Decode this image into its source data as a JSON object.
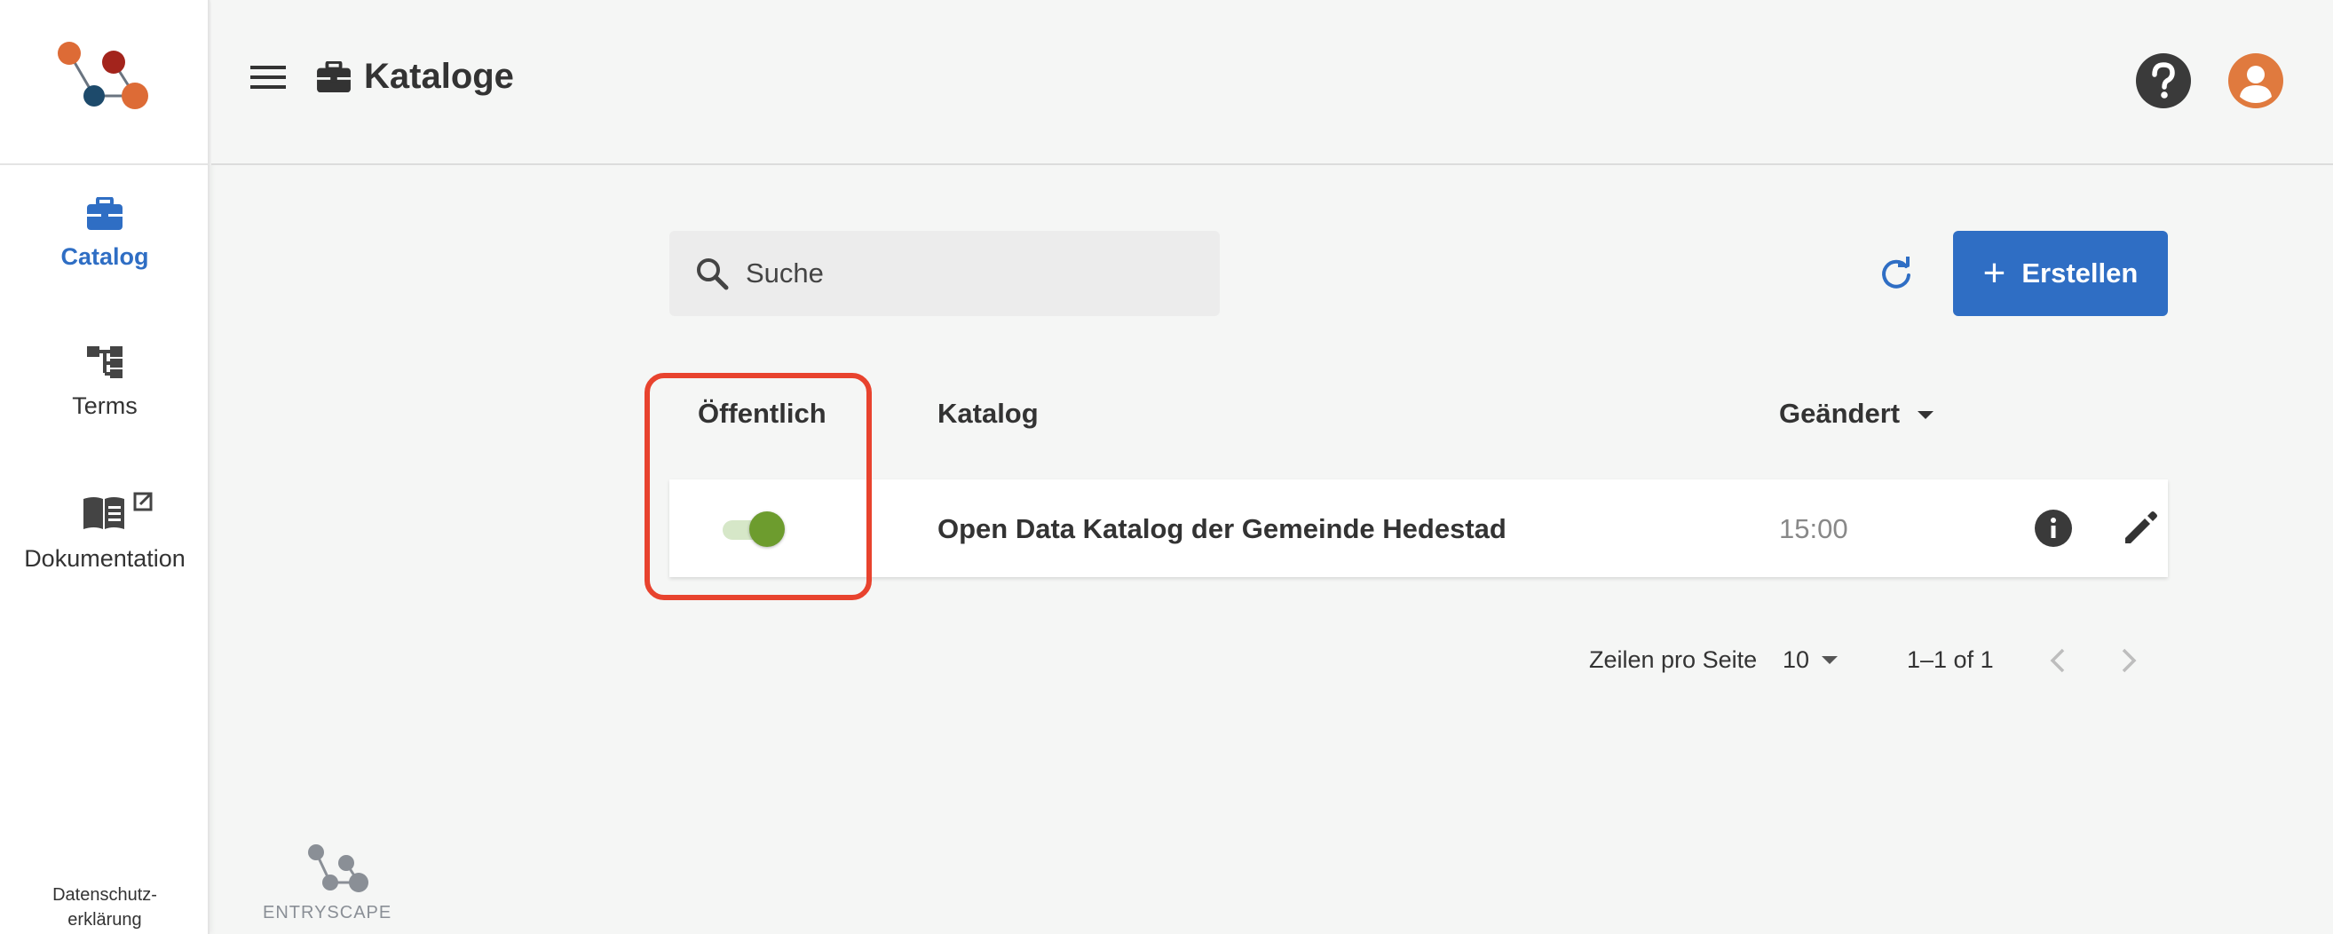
{
  "sidebar": {
    "items": [
      {
        "label": "Catalog",
        "icon": "briefcase-icon",
        "active": true
      },
      {
        "label": "Terms",
        "icon": "hierarchy-icon",
        "active": false
      },
      {
        "label": "Dokumentation",
        "icon": "book-external-icon",
        "active": false
      }
    ],
    "footer_line1": "Datenschutz-",
    "footer_line2": "erklärung"
  },
  "header": {
    "title": "Kataloge",
    "title_icon": "briefcase-icon",
    "help_icon": "help-circle-icon",
    "avatar_icon": "account-circle-icon"
  },
  "toolbar": {
    "search_placeholder": "Suche",
    "search_value": "",
    "create_label": "Erstellen"
  },
  "table": {
    "columns": {
      "public": "Öffentlich",
      "catalog": "Katalog",
      "modified": "Geändert"
    },
    "sort_column": "modified",
    "rows": [
      {
        "public": true,
        "name": "Open Data Katalog der Gemeinde Hedestad",
        "modified": "15:00"
      }
    ]
  },
  "pagination": {
    "rows_per_page_label": "Zeilen pro Seite",
    "rows_per_page": "10",
    "range": "1–1 of 1"
  },
  "brand": {
    "name": "ENTRYSCAPE"
  },
  "colors": {
    "accent": "#2f6ec4",
    "toggle_on": "#6d9c2e",
    "highlight": "#e8432e",
    "avatar": "#e07a3e"
  }
}
